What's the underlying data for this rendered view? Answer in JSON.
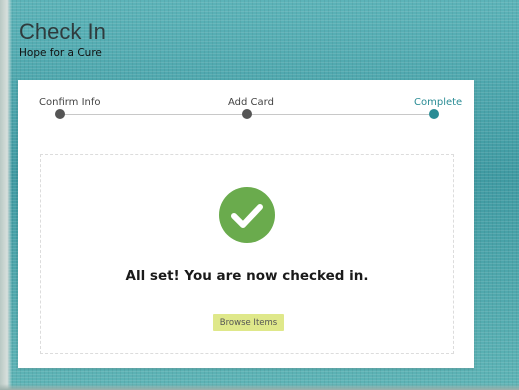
{
  "header": {
    "title": "Check In",
    "subtitle": "Hope for a Cure"
  },
  "stepper": {
    "steps": [
      {
        "label": "Confirm Info",
        "state": "done"
      },
      {
        "label": "Add Card",
        "state": "done"
      },
      {
        "label": "Complete",
        "state": "active"
      }
    ]
  },
  "confirmation": {
    "icon": "check-circle-icon",
    "message": "All set! You are now checked in.",
    "button_label": "Browse Items"
  },
  "colors": {
    "accent": "#2a8c95",
    "success": "#6aab4d",
    "button": "#dfe88a"
  }
}
